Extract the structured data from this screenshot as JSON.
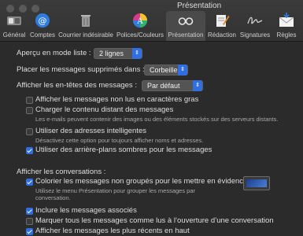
{
  "window": {
    "title": "Présentation"
  },
  "toolbar": {
    "tabs": [
      {
        "label": "Général",
        "icon": "general-switch-icon"
      },
      {
        "label": "Comptes",
        "icon": "at-sign-icon"
      },
      {
        "label": "Courrier indésirable",
        "icon": "trash-icon"
      },
      {
        "label": "Polices/Couleurs",
        "icon": "color-wheel-icon"
      },
      {
        "label": "Présentation",
        "icon": "glasses-icon",
        "active": true
      },
      {
        "label": "Rédaction",
        "icon": "compose-icon"
      },
      {
        "label": "Signatures",
        "icon": "signature-icon"
      },
      {
        "label": "Règles",
        "icon": "rules-envelope-icon"
      }
    ]
  },
  "list_preview": {
    "label": "Aperçu en mode liste :",
    "value": "2 lignes"
  },
  "deleted_messages": {
    "label": "Placer les messages supprimés dans :",
    "value": "Corbeille"
  },
  "headers": {
    "label": "Afficher les en-têtes des messages :",
    "value": "Par défaut"
  },
  "options1": [
    {
      "label": "Afficher les messages non lus en caractères gras",
      "checked": false
    },
    {
      "label": "Charger le contenu distant des messages",
      "checked": false,
      "help": "Les e-mails peuvent contenir des images ou des éléments stockés sur des serveurs distants."
    },
    {
      "label": "Utiliser des adresses intelligentes",
      "checked": false,
      "help": "Désactivez cette option pour toujours afficher noms et adresses."
    },
    {
      "label": "Utiliser des arrière-plans sombres pour les messages",
      "checked": true
    }
  ],
  "conversations": {
    "label": "Afficher les conversations :",
    "options": [
      {
        "label": "Colorier les messages non groupés pour les mettre en évidence",
        "checked": true,
        "help1": "Utilisez le menu Présentation pour grouper les messages par",
        "help2": "conversation."
      },
      {
        "label": "Inclure les messages associés",
        "checked": true
      },
      {
        "label": "Marquer tous les messages comme lus à l’ouverture d’une conversation",
        "checked": false
      },
      {
        "label": "Afficher les messages les plus récents en haut",
        "checked": true
      }
    ]
  },
  "colors": {
    "accent": "#2f6fe0",
    "background": "#2b2b2b"
  }
}
